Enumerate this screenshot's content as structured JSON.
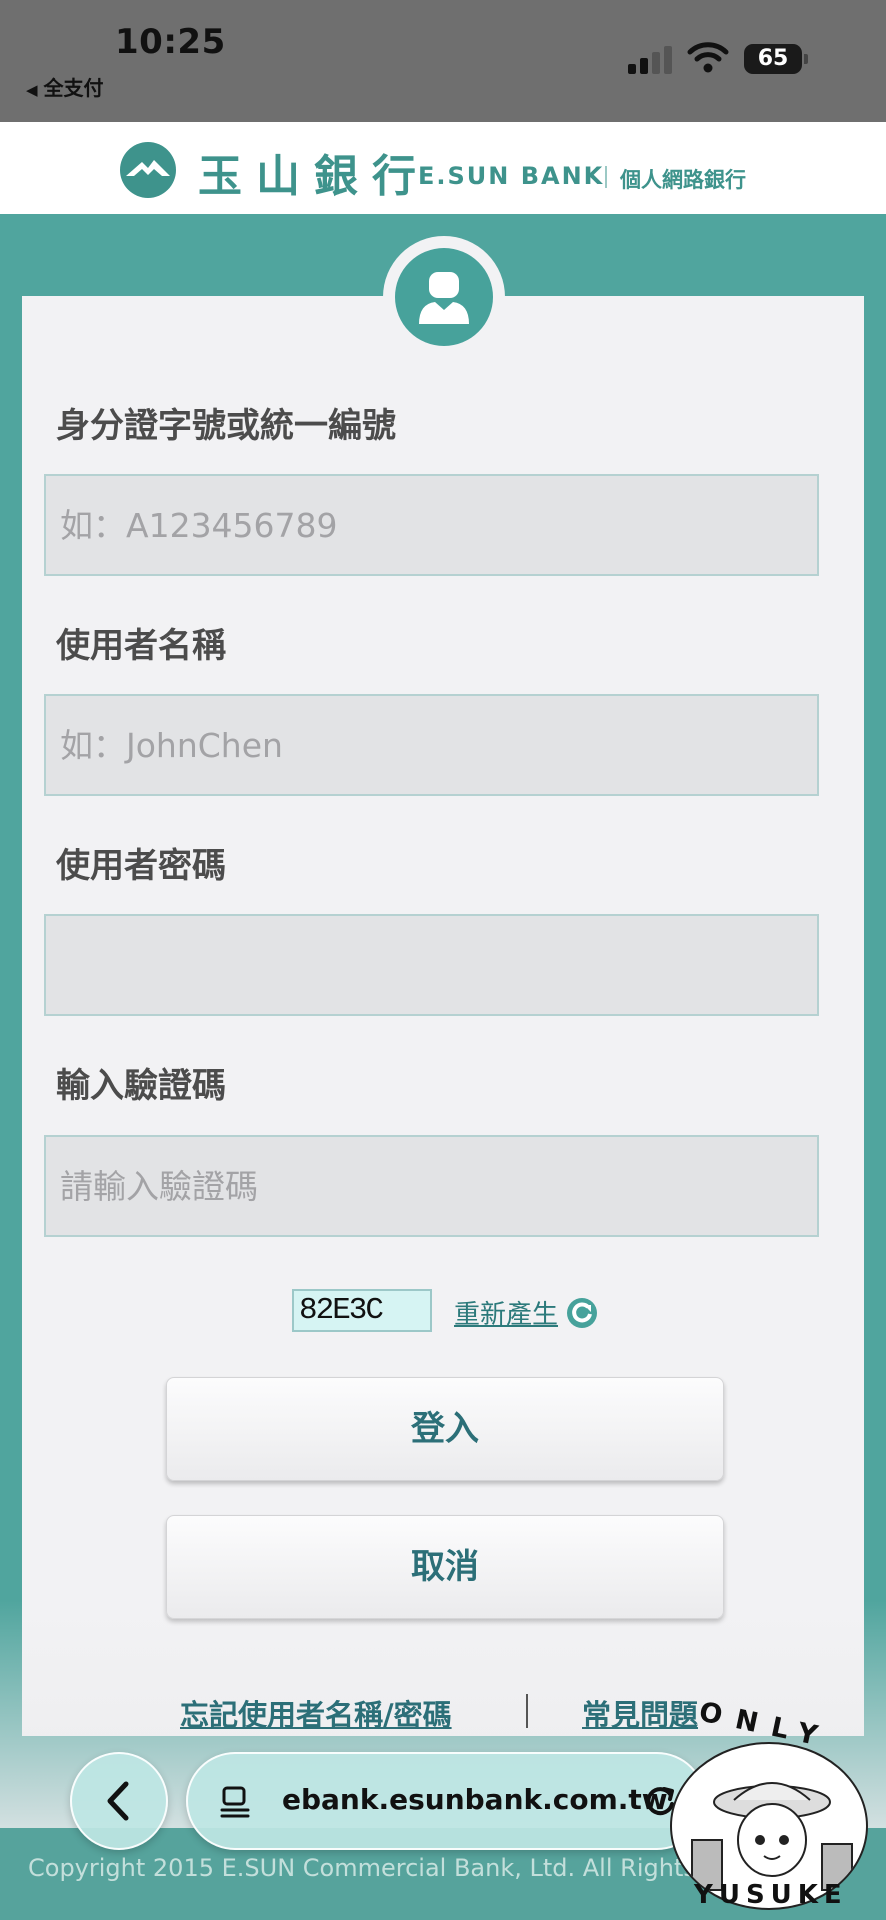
{
  "status_bar": {
    "time": "10:25",
    "back_app": "全支付",
    "battery": "65"
  },
  "header": {
    "brand_zh": "玉山銀行",
    "brand_en": "E.SUN BANK",
    "brand_sub": "個人網路銀行"
  },
  "form": {
    "id_label": "身分證字號或統一編號",
    "id_placeholder": "如：A123456789",
    "username_label": "使用者名稱",
    "username_placeholder": "如：JohnChen",
    "password_label": "使用者密碼",
    "password_placeholder": "",
    "captcha_label": "輸入驗證碼",
    "captcha_placeholder": "請輸入驗證碼",
    "captcha_code": "82E3C",
    "regenerate_label": "重新產生"
  },
  "buttons": {
    "login": "登入",
    "cancel": "取消"
  },
  "links": {
    "forgot": "忘記使用者名稱/密碼",
    "faq": "常見問題"
  },
  "footer": {
    "copyright": "Copyright 2015 E.SUN Commercial Bank, Ltd. All Rights Reserved."
  },
  "browser": {
    "url": "ebank.esunbank.com.tw"
  },
  "watermark": {
    "top_text": "ONLY",
    "bottom_text": "YUSUKE"
  },
  "colors": {
    "teal_bg": "#50a59e",
    "brand_teal": "#3e938c",
    "button_text": "#2c6f78",
    "input_bg": "#e2e3e5"
  }
}
